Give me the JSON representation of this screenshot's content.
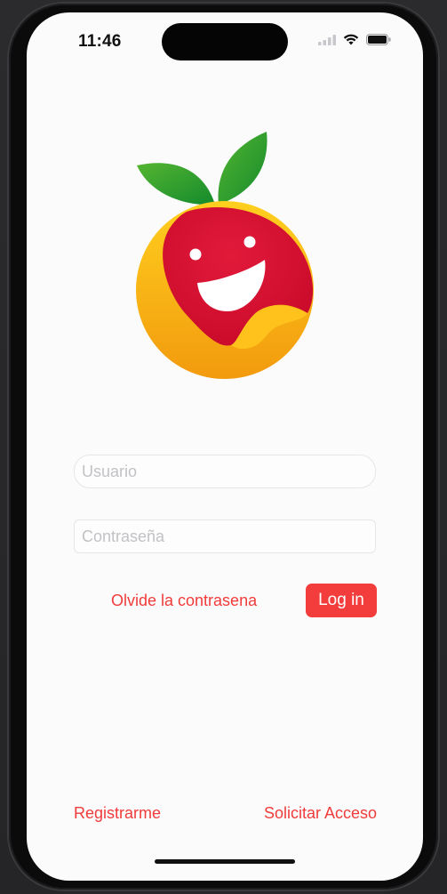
{
  "status_bar": {
    "time": "11:46",
    "icons": [
      "signal-icon",
      "wifi-icon",
      "battery-icon"
    ]
  },
  "logo": {
    "name": "apple-mascot-logo",
    "colors": {
      "red": "#d8102f",
      "leaf": "#2e9a2a",
      "yellow": "#f5b41a"
    }
  },
  "form": {
    "username_placeholder": "Usuario",
    "username_value": "",
    "password_placeholder": "Contraseña",
    "password_value": "",
    "forgot_label": "Olvide la contrasena",
    "login_label": "Log in"
  },
  "footer": {
    "register_label": "Registrarme",
    "request_access_label": "Solicitar Acceso"
  },
  "theme": {
    "accent": "#ef3c3a",
    "background": "#fbfbfc"
  }
}
